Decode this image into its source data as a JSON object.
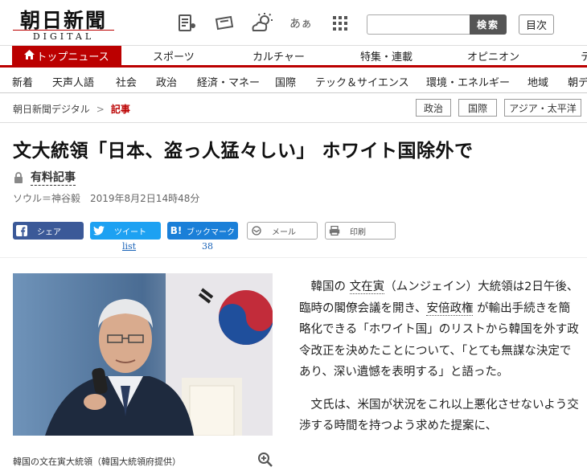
{
  "header": {
    "logo_main": "朝日新聞",
    "logo_sub": "DIGITAL",
    "search_button": "検索",
    "search_placeholder": "",
    "contents_button": "目次",
    "icons": [
      "newspaper-icon",
      "ticket-icon",
      "weather-icon",
      "font-size-icon",
      "app-grid-icon"
    ],
    "font_icon_text": "あぁ"
  },
  "top_nav": [
    {
      "label": "トップニュース",
      "active": true
    },
    {
      "label": "スポーツ"
    },
    {
      "label": "カルチャー"
    },
    {
      "label": "特集・連載"
    },
    {
      "label": "オピニオン"
    },
    {
      "label": "テ"
    }
  ],
  "sub_nav": [
    "新着",
    "天声人語",
    "社会",
    "政治",
    "経済・マネー",
    "国際",
    "テック＆サイエンス",
    "環境・エネルギー",
    "地域",
    "朝デ"
  ],
  "breadcrumb": {
    "home": "朝日新聞デジタル",
    "separator": ">",
    "current": "記事"
  },
  "tags": [
    "政治",
    "国際",
    "アジア・太平洋"
  ],
  "article": {
    "title": "文大統領「日本、盗っ人猛々しい」 ホワイト国除外で",
    "paid_label": "有料記事",
    "byline": "ソウル＝神谷毅　2019年8月2日14時48分",
    "photo_caption": "韓国の文在寅大統領（韓国大統領府提供）",
    "p1_a": "韓国の",
    "p1_link1": "文在寅",
    "p1_b": "（ムンジェイン）大統領は2日午後、臨時の閣僚会議を開き、",
    "p1_link2": "安倍政権",
    "p1_c": "が輸出手続きを簡略化できる「ホワイト国」のリストから韓国を外す政令改正を決めたことについて、「とても無謀な決定であり、深い遺憾を表明する」と語った。",
    "p2": "文氏は、米国が状況をこれ以上悪化させないよう交渉する時間を持つよう求めた提案に、"
  },
  "share": {
    "facebook": "シェア",
    "twitter": "ツイート",
    "twitter_count": "list",
    "hatena": "ブックマーク",
    "hatena_count": "38",
    "mail": "メール",
    "print": "印刷"
  },
  "colors": {
    "accent": "#bb0000",
    "facebook": "#3b5998",
    "twitter": "#1da1f2",
    "hatena": "#1a7fd8"
  }
}
